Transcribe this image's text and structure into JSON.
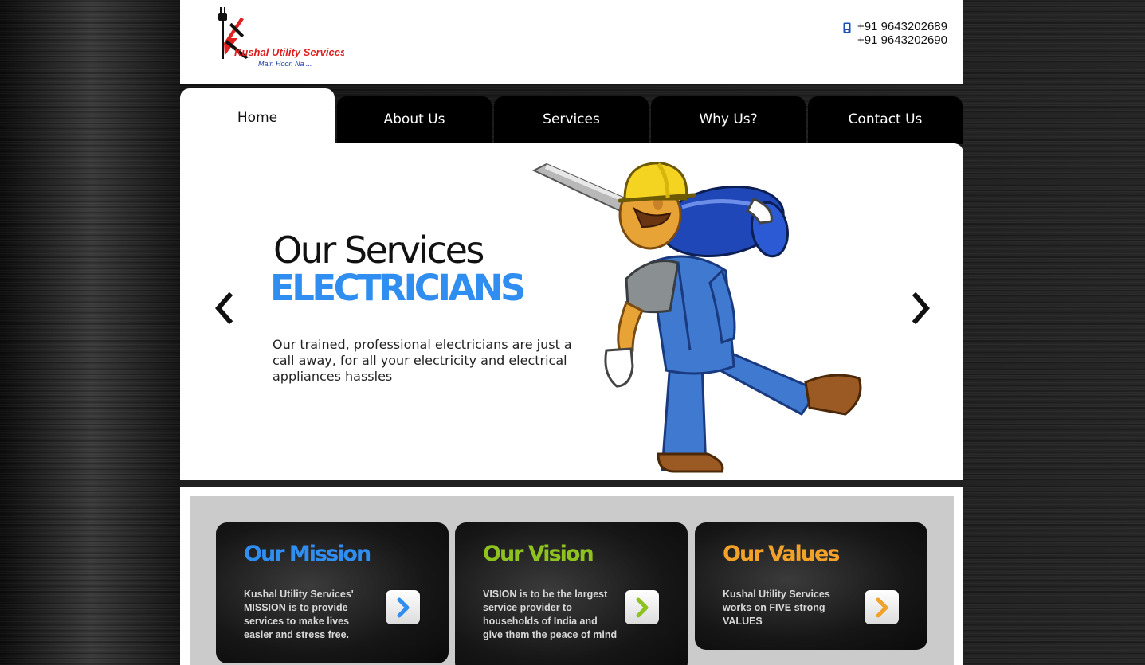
{
  "header": {
    "logo": {
      "name": "Kushal Utility Services",
      "tagline": "Main Hoon Na ..."
    },
    "phones": [
      "+91 9643202689",
      "+91 9643202690"
    ]
  },
  "nav": {
    "tabs": [
      {
        "label": "Home",
        "active": true
      },
      {
        "label": "About Us",
        "active": false
      },
      {
        "label": "Services",
        "active": false
      },
      {
        "label": "Why Us?",
        "active": false
      },
      {
        "label": "Contact Us",
        "active": false
      }
    ]
  },
  "slider": {
    "title": "Our Services",
    "subtitle": "ELECTRICIANS",
    "description": "Our trained, professional electricians are just a call away, for all your electricity and electrical appliances hassles",
    "prev_icon": "chevron-left-icon",
    "next_icon": "chevron-right-icon",
    "image": "electrician-illustration"
  },
  "cards": [
    {
      "title": "Our Mission",
      "text": "Kushal Utility Services' MISSION is to provide services to make lives easier and stress free.",
      "color": "#2f8ef0",
      "icon": "chevron-right-icon"
    },
    {
      "title": "Our Vision",
      "text": "VISION is to be the largest service provider to households of India and give them the peace of mind",
      "color": "#8dc21f",
      "icon": "chevron-right-icon"
    },
    {
      "title": "Our Values",
      "text": "Kushal Utility Services works on FIVE strong VALUES",
      "color": "#f2a229",
      "icon": "chevron-right-icon"
    }
  ],
  "colors": {
    "accent_blue": "#2f8ef0",
    "accent_green": "#8dc21f",
    "accent_orange": "#f2a229",
    "logo_red": "#e02020"
  }
}
